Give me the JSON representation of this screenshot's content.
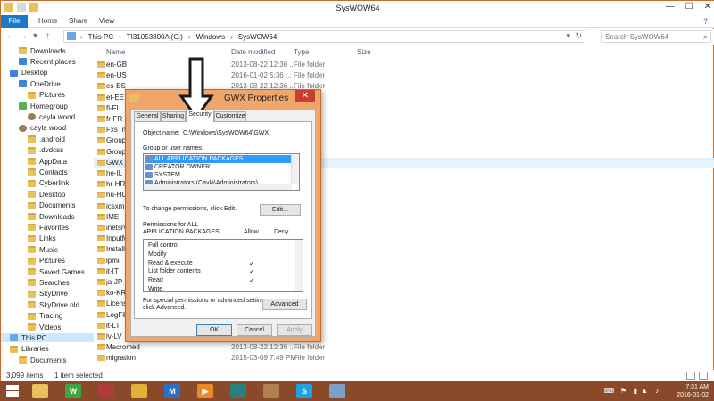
{
  "explorer": {
    "title": "SysWOW64",
    "ribbon_tabs": [
      "File",
      "Home",
      "Share",
      "View"
    ],
    "help_glyph": "?",
    "breadcrumb": [
      "This PC",
      "TI31053800A (C:)",
      "Windows",
      "SysWOW64"
    ],
    "search_placeholder": "Search SysWOW64",
    "columns": {
      "name": "Name",
      "date": "Date modified",
      "type": "Type",
      "size": "Size"
    }
  },
  "nav": [
    {
      "label": "Downloads",
      "icon": "folder-icon",
      "indent": 1
    },
    {
      "label": "Recent places",
      "icon": "recent-icon",
      "indent": 1
    },
    {
      "label": "Desktop",
      "icon": "desktop-icon",
      "indent": 0
    },
    {
      "label": "OneDrive",
      "icon": "cloud-icon",
      "indent": 1
    },
    {
      "label": "Pictures",
      "icon": "folder-icon",
      "indent": 2
    },
    {
      "label": "Homegroup",
      "icon": "homegroup-icon",
      "indent": 1
    },
    {
      "label": "cayla wood",
      "icon": "user-icon",
      "indent": 2
    },
    {
      "label": "cayla wood",
      "icon": "user-icon",
      "indent": 1
    },
    {
      "label": ".android",
      "icon": "folder-icon",
      "indent": 2
    },
    {
      "label": ".dvdcss",
      "icon": "folder-icon",
      "indent": 2
    },
    {
      "label": "AppData",
      "icon": "folder-icon",
      "indent": 2
    },
    {
      "label": "Contacts",
      "icon": "folder-icon",
      "indent": 2
    },
    {
      "label": "Cyberlink",
      "icon": "folder-icon",
      "indent": 2
    },
    {
      "label": "Desktop",
      "icon": "folder-icon",
      "indent": 2
    },
    {
      "label": "Documents",
      "icon": "folder-icon",
      "indent": 2
    },
    {
      "label": "Downloads",
      "icon": "folder-icon",
      "indent": 2
    },
    {
      "label": "Favorites",
      "icon": "folder-icon",
      "indent": 2
    },
    {
      "label": "Links",
      "icon": "folder-icon",
      "indent": 2
    },
    {
      "label": "Music",
      "icon": "folder-icon",
      "indent": 2
    },
    {
      "label": "Pictures",
      "icon": "folder-icon",
      "indent": 2
    },
    {
      "label": "Saved Games",
      "icon": "folder-icon",
      "indent": 2
    },
    {
      "label": "Searches",
      "icon": "folder-icon",
      "indent": 2
    },
    {
      "label": "SkyDrive",
      "icon": "folder-icon",
      "indent": 2
    },
    {
      "label": "SkyDrive.old",
      "icon": "folder-icon",
      "indent": 2
    },
    {
      "label": "Tracing",
      "icon": "folder-icon",
      "indent": 2
    },
    {
      "label": "Videos",
      "icon": "folder-icon",
      "indent": 2
    },
    {
      "label": "This PC",
      "icon": "pc-icon",
      "indent": 0,
      "selected": true
    },
    {
      "label": "Libraries",
      "icon": "library-icon",
      "indent": 0
    },
    {
      "label": "Documents",
      "icon": "folder-icon",
      "indent": 1
    }
  ],
  "files": [
    {
      "name": "en-GB",
      "date": "2013-08-22 12:36 ...",
      "type": "File folder"
    },
    {
      "name": "en-US",
      "date": "2016-01-02 5:36 ...",
      "type": "File folder"
    },
    {
      "name": "es-ES",
      "date": "2013-08-22 12:36 ...",
      "type": "File folder"
    },
    {
      "name": "et-EE",
      "date": "",
      "type": ""
    },
    {
      "name": "fi-FI",
      "date": "",
      "type": ""
    },
    {
      "name": "fr-FR",
      "date": "",
      "type": ""
    },
    {
      "name": "FxsTmp",
      "date": "",
      "type": ""
    },
    {
      "name": "GroupP",
      "date": "",
      "type": ""
    },
    {
      "name": "GroupP",
      "date": "",
      "type": ""
    },
    {
      "name": "GWX",
      "date": "",
      "type": "",
      "selected": true
    },
    {
      "name": "he-IL",
      "date": "",
      "type": ""
    },
    {
      "name": "hr-HR",
      "date": "",
      "type": ""
    },
    {
      "name": "hu-HU",
      "date": "",
      "type": ""
    },
    {
      "name": "icsxml",
      "date": "",
      "type": ""
    },
    {
      "name": "IME",
      "date": "",
      "type": ""
    },
    {
      "name": "inetsrv",
      "date": "",
      "type": ""
    },
    {
      "name": "InputM",
      "date": "",
      "type": ""
    },
    {
      "name": "InstallS",
      "date": "",
      "type": ""
    },
    {
      "name": "lpmi",
      "date": "",
      "type": ""
    },
    {
      "name": "it-IT",
      "date": "",
      "type": ""
    },
    {
      "name": "ja-JP",
      "date": "",
      "type": ""
    },
    {
      "name": "ko-KR",
      "date": "",
      "type": ""
    },
    {
      "name": "License",
      "date": "",
      "type": ""
    },
    {
      "name": "LogFile",
      "date": "",
      "type": ""
    },
    {
      "name": "lt-LT",
      "date": "",
      "type": ""
    },
    {
      "name": "lv-LV",
      "date": "",
      "type": ""
    },
    {
      "name": "Macromed",
      "date": "2013-08-22 12:36 ...",
      "type": "File folder"
    },
    {
      "name": "migration",
      "date": "2015-03-09 7:49 PM",
      "type": "File folder"
    }
  ],
  "status": {
    "count": "3,099 items",
    "selected": "1 item selected"
  },
  "dialog": {
    "title": "GWX Properties",
    "close_glyph": "✕",
    "tabs": [
      "General",
      "Sharing",
      "Security",
      "Customize"
    ],
    "object_name_label": "Object name:",
    "object_name_value": "C:\\Windows\\SysWOW64\\GWX",
    "group_label": "Group or user names:",
    "groups": [
      "ALL APPLICATION PACKAGES",
      "CREATOR OWNER",
      "SYSTEM",
      "Administrators (Cayla\\Administrators)"
    ],
    "change_perm_text": "To change permissions, click Edit.",
    "edit_button": "Edit...",
    "perm_for_line1": "Permissions for ALL",
    "perm_for_line2": "APPLICATION PACKAGES",
    "allow_header": "Allow",
    "deny_header": "Deny",
    "permissions": [
      {
        "name": "Full control",
        "allow": "",
        "deny": ""
      },
      {
        "name": "Modify",
        "allow": "",
        "deny": ""
      },
      {
        "name": "Read & execute",
        "allow": "✓",
        "deny": ""
      },
      {
        "name": "List folder contents",
        "allow": "✓",
        "deny": ""
      },
      {
        "name": "Read",
        "allow": "✓",
        "deny": ""
      },
      {
        "name": "Write",
        "allow": "",
        "deny": ""
      }
    ],
    "special_text_line1": "For special permissions or advanced settings,",
    "special_text_line2": "click Advanced.",
    "advanced_button": "Advanced",
    "ok_button": "OK",
    "cancel_button": "Cancel",
    "apply_button": "Apply"
  },
  "taskbar": {
    "icons": [
      {
        "name": "file-explorer-icon",
        "color": "#e9c05a",
        "glyph": ""
      },
      {
        "name": "wordpad-icon",
        "color": "#3fa63f",
        "glyph": "W"
      },
      {
        "name": "winrar-icon",
        "color": "#b03a3a",
        "glyph": ""
      },
      {
        "name": "chrome-icon",
        "color": "#dfb33a",
        "glyph": ""
      },
      {
        "name": "mail-icon",
        "color": "#2d6fc4",
        "glyph": "M"
      },
      {
        "name": "media-player-icon",
        "color": "#e88a2a",
        "glyph": "▶"
      },
      {
        "name": "camera-icon",
        "color": "#2a7f7f",
        "glyph": ""
      },
      {
        "name": "package-icon",
        "color": "#b08050",
        "glyph": ""
      },
      {
        "name": "skype-icon",
        "color": "#1ea0e6",
        "glyph": "S"
      },
      {
        "name": "paint-icon",
        "color": "#7aa0c8",
        "glyph": ""
      }
    ],
    "time": "7:31 AM",
    "date": "2016-01-02"
  }
}
